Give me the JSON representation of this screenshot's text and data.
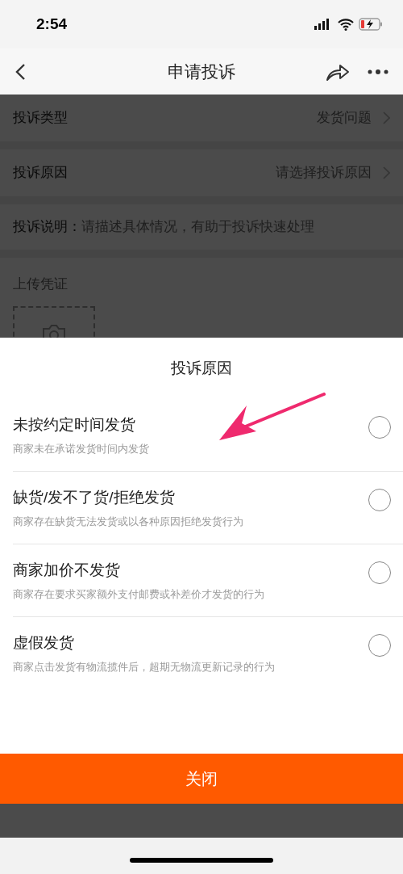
{
  "status_bar": {
    "time": "2:54"
  },
  "nav": {
    "title": "申请投诉"
  },
  "form": {
    "rows": [
      {
        "kind": "select",
        "label": "投诉类型",
        "value": "发货问题"
      },
      {
        "kind": "select",
        "label": "投诉原因",
        "placeholder": "请选择投诉原因"
      },
      {
        "kind": "text",
        "label": "投诉说明：",
        "placeholder": "请描述具体情况，有助于投诉快速处理"
      }
    ],
    "upload": {
      "label": "上传凭证"
    }
  },
  "sheet": {
    "title": "投诉原因",
    "options": [
      {
        "title": "未按约定时间发货",
        "description": "商家未在承诺发货时间内发货",
        "selected": false
      },
      {
        "title": "缺货/发不了货/拒绝发货",
        "description": "商家存在缺货无法发货或以各种原因拒绝发货行为",
        "selected": false
      },
      {
        "title": "商家加价不发货",
        "description": "商家存在要求买家额外支付邮费或补差价才发货的行为",
        "selected": false
      },
      {
        "title": "虚假发货",
        "description": "商家点击发货有物流揽件后，超期无物流更新记录的行为",
        "selected": false
      }
    ],
    "close_button": "关闭"
  }
}
